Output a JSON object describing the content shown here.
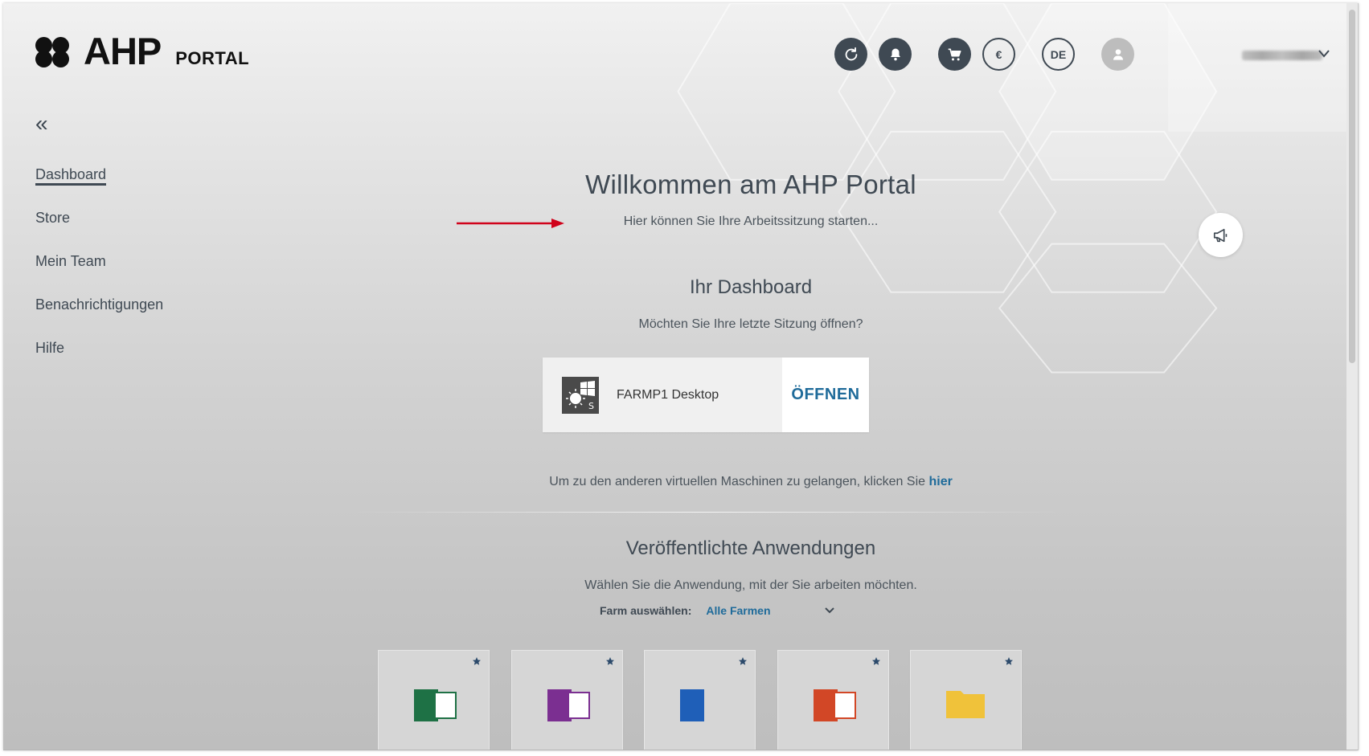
{
  "header": {
    "logo_text": "AHP",
    "logo_sub": "PORTAL",
    "language": "DE",
    "currency_symbol": "€",
    "icons": [
      "refresh-icon",
      "bell-icon",
      "cart-icon",
      "euro-icon",
      "language-icon",
      "user-icon",
      "chevron-down-icon"
    ]
  },
  "sidebar": {
    "collapse_symbol": "«",
    "items": [
      {
        "label": "Dashboard",
        "active": true
      },
      {
        "label": "Store"
      },
      {
        "label": "Mein Team"
      },
      {
        "label": "Benachrichtigungen"
      },
      {
        "label": "Hilfe"
      }
    ]
  },
  "main": {
    "title": "Willkommen am AHP Portal",
    "subtitle": "Hier können Sie Ihre Arbeitssitzung starten...",
    "dashboard_heading": "Ihr Dashboard",
    "dashboard_question": "Möchten Sie Ihre letzte Sitzung öffnen?",
    "session": {
      "name": "FARMP1 Desktop",
      "open_label": "ÖFFNEN"
    },
    "other_vms_text": "Um zu den anderen virtuellen Maschinen zu gelangen, klicken Sie",
    "other_vms_link": "hier",
    "apps_heading": "Veröffentlichte Anwendungen",
    "apps_prompt": "Wählen Sie die Anwendung, mit der Sie arbeiten möchten.",
    "farm_label": "Farm auswählen:",
    "farm_value": "Alle Farmen",
    "apps": [
      {
        "icon": "excel-icon",
        "color": "#1e7145"
      },
      {
        "icon": "onenote-icon",
        "color": "#7b2f91"
      },
      {
        "icon": "word-icon",
        "color": "#1f5fb8"
      },
      {
        "icon": "powerpoint-icon",
        "color": "#d24726"
      },
      {
        "icon": "folder-icon",
        "color": "#f0c23a"
      }
    ]
  },
  "colors": {
    "accent": "#1f6b9a",
    "dark": "#3f4953",
    "arrow": "#d0021b"
  }
}
